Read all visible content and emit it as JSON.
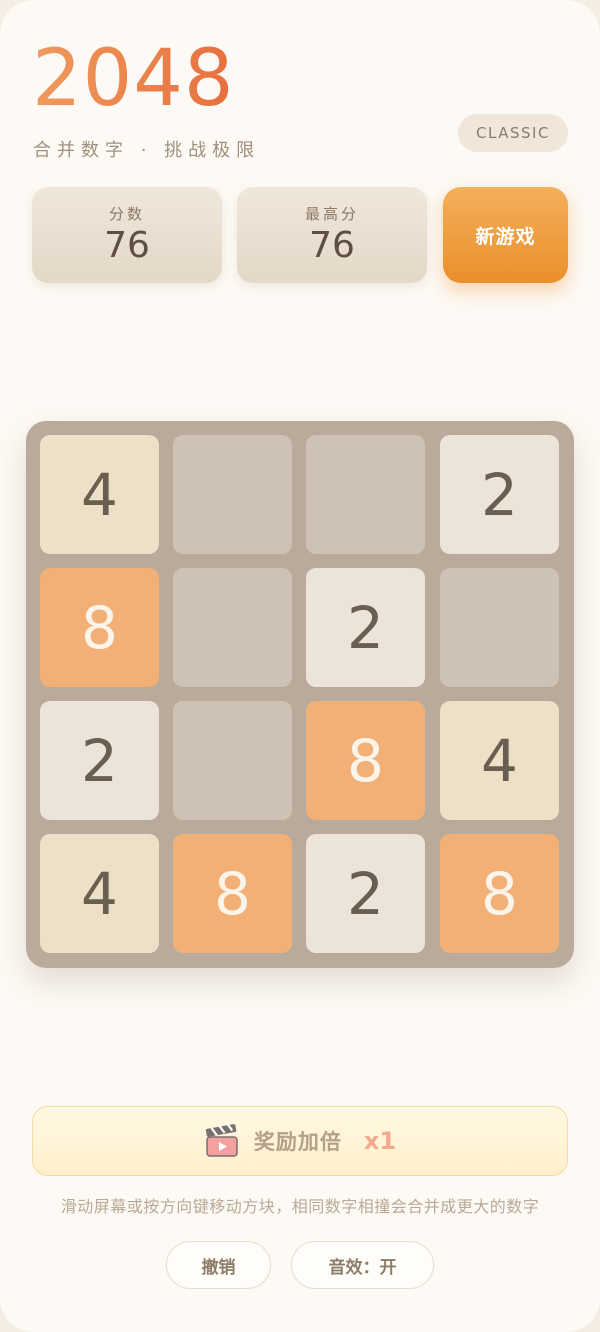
{
  "header": {
    "title": "2048",
    "subtitle": "合并数字 · 挑战极限",
    "mode": "CLASSIC"
  },
  "scores": {
    "score_label": "分数",
    "score_value": "76",
    "best_label": "最高分",
    "best_value": "76"
  },
  "actions": {
    "new_game": "新游戏",
    "undo": "撤销",
    "sound": "音效：开"
  },
  "board": {
    "tiles": [
      [
        "4",
        "",
        "",
        "2"
      ],
      [
        "8",
        "",
        "2",
        ""
      ],
      [
        "2",
        "",
        "8",
        "4"
      ],
      [
        "4",
        "8",
        "2",
        "8"
      ]
    ]
  },
  "reward": {
    "icon": "clapperboard-icon",
    "label": "奖励加倍",
    "multiplier": "x1"
  },
  "hint": "滑动屏幕或按方向键移动方块，相同数字相撞会合并成更大的数字",
  "colors": {
    "title": "#ec8a52",
    "new_game": "#ea8f2c",
    "tile_2": "#ede4d9",
    "tile_4": "#ece0c6",
    "tile_8": "#f2b077",
    "board": "#b9aa9b"
  }
}
